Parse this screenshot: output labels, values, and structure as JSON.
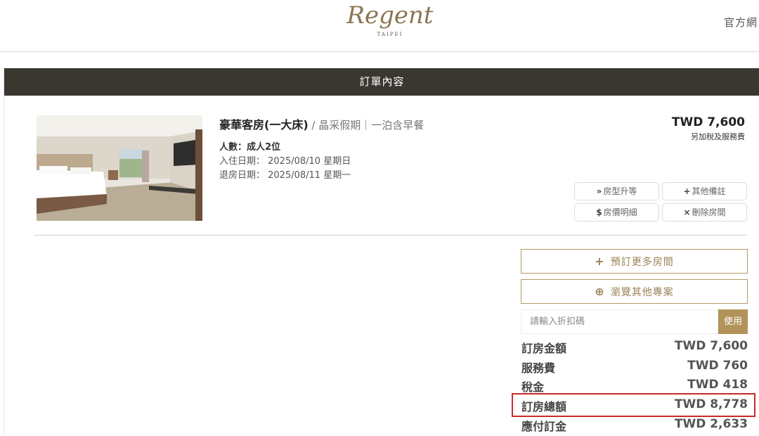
{
  "header": {
    "logo_word": "Regent",
    "logo_sub": "TAIPEI",
    "official_link": "官方網"
  },
  "panel": {
    "title": "訂單內容"
  },
  "room": {
    "name": "豪華客房(一大床)",
    "package": " / 晶采假期｜一泊含早餐",
    "guests": "人數：成人2位",
    "checkin": "入住日期： 2025/08/10 星期日",
    "checkout": "退房日期： 2025/08/11 星期一",
    "price": "TWD 7,600",
    "price_note": "另加稅及服務費",
    "actions": {
      "upgrade": "房型升等",
      "remarks": "其他備註",
      "price_detail": "房價明細",
      "delete": "刪除房間"
    }
  },
  "summary": {
    "book_more": "預訂更多房間",
    "browse_more": "瀏覽其他專案",
    "discount_placeholder": "請輸入折扣碼",
    "apply": "使用",
    "rows": [
      {
        "label": "訂房金額",
        "value": "TWD 7,600"
      },
      {
        "label": "服務費",
        "value": "TWD 760"
      },
      {
        "label": "稅金",
        "value": "TWD 418"
      },
      {
        "label": "訂房總額",
        "value": "TWD 8,778"
      },
      {
        "label": "應付訂金",
        "value": "TWD 2,633"
      }
    ]
  },
  "colors": {
    "title_bar": "#3a3731",
    "gold": "#b2935a",
    "highlight": "#cc2a2a"
  }
}
